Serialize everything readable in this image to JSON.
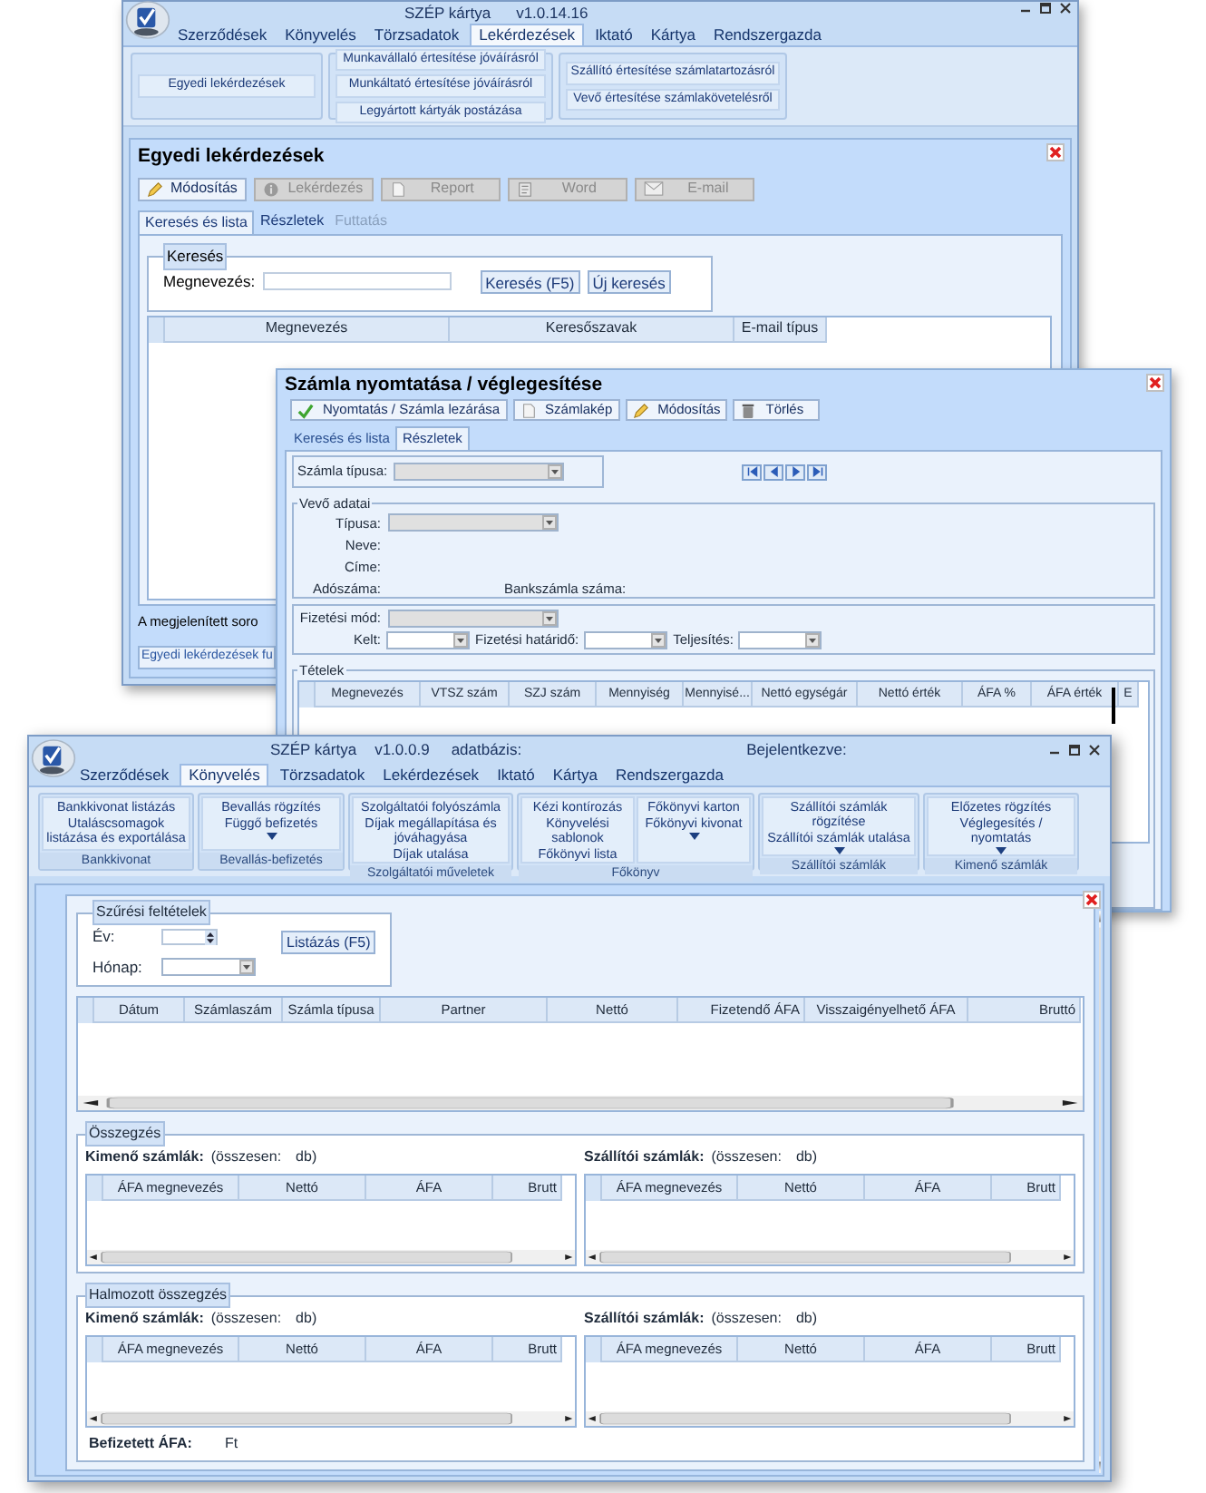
{
  "back_window": {
    "app_title": "SZÉP kártya",
    "version": "v1.0.14.16",
    "menu": [
      {
        "label": "Szerződések",
        "selected": false
      },
      {
        "label": "Könyvelés",
        "selected": false
      },
      {
        "label": "Törzsadatok",
        "selected": false
      },
      {
        "label": "Lekérdezések",
        "selected": true
      },
      {
        "label": "Iktató",
        "selected": false
      },
      {
        "label": "Kártya",
        "selected": false
      },
      {
        "label": "Rendszergazda",
        "selected": false
      }
    ],
    "ribbon": [
      {
        "items": [
          "Egyedi lekérdezések"
        ]
      },
      {
        "items": [
          "Munkavállaló értesítése jóváírásról",
          "Munkáltató értesítése jóváírásról",
          "Legyártott kártyák postázása"
        ]
      },
      {
        "items": [
          "Szállító értesítése számlatartozásról",
          "Vevő értesítése számlakövetelésről"
        ]
      }
    ],
    "panel": {
      "title": "Egyedi lekérdezések",
      "toolbar": [
        {
          "label": "Módosítás",
          "kind": "pencil",
          "disabled": false
        },
        {
          "label": "Lekérdezés",
          "kind": "info",
          "disabled": true
        },
        {
          "label": "Report",
          "kind": "doc",
          "disabled": true
        },
        {
          "label": "Word",
          "kind": "word",
          "disabled": true
        },
        {
          "label": "E-mail",
          "kind": "mail",
          "disabled": true
        }
      ],
      "tabs": [
        {
          "label": "Keresés és lista",
          "selected": true,
          "disabled": false
        },
        {
          "label": "Részletek",
          "selected": false,
          "disabled": false
        },
        {
          "label": "Futtatás",
          "selected": false,
          "disabled": true
        }
      ],
      "search_group": {
        "title": "Keresés",
        "field_label": "Megnevezés:",
        "buttons": [
          "Keresés (F5)",
          "Új keresés"
        ]
      },
      "grid_columns": [
        "Megnevezés",
        "Keresőszavak",
        "E-mail típus"
      ],
      "footer_note": "A megjelenített soro",
      "bottom_tab": "Egyedi lekérdezések fu"
    }
  },
  "dialog_window": {
    "title": "Számla nyomtatása / véglegesítése",
    "toolbar": [
      {
        "label": "Nyomtatás / Számla lezárása",
        "kind": "check"
      },
      {
        "label": "Számlakép",
        "kind": "doc"
      },
      {
        "label": "Módosítás",
        "kind": "pencil"
      },
      {
        "label": "Törlés",
        "kind": "bin"
      }
    ],
    "tabs": [
      {
        "label": "Keresés és lista",
        "selected": false
      },
      {
        "label": "Részletek",
        "selected": true
      }
    ],
    "invoice_type": {
      "label": "Számla típusa:",
      "disabled": true
    },
    "customer_group": {
      "title": "Vevő adatai",
      "type_label": "Típusa:",
      "type_disabled": true,
      "name_label": "Neve:",
      "address_label": "Címe:",
      "tax_label": "Adószáma:",
      "bank_label": "Bankszámla száma:"
    },
    "payment": {
      "method_label": "Fizetési mód:",
      "method_disabled": true,
      "dates": [
        {
          "label": "Kelt:",
          "disabled": false
        },
        {
          "label": "Fizetési határidő:",
          "disabled": false
        },
        {
          "label": "Teljesítés:",
          "disabled": false
        }
      ]
    },
    "items_group": {
      "title": "Tételek",
      "columns": [
        "Megnevezés",
        "VTSZ szám",
        "SZJ szám",
        "Mennyiség",
        "Mennyisé...",
        "Nettó egységár",
        "Nettó érték",
        "ÁFA %",
        "ÁFA érték",
        "E"
      ]
    }
  },
  "front_window": {
    "app_title": "SZÉP kártya",
    "version": "v1.0.0.9",
    "database_label": "adatbázis:",
    "login_label": "Bejelentkezve:",
    "menu": [
      {
        "label": "Szerződések",
        "selected": false
      },
      {
        "label": "Könyvelés",
        "selected": true
      },
      {
        "label": "Törzsadatok",
        "selected": false
      },
      {
        "label": "Lekérdezések",
        "selected": false
      },
      {
        "label": "Iktató",
        "selected": false
      },
      {
        "label": "Kártya",
        "selected": false
      },
      {
        "label": "Rendszergazda",
        "selected": false
      }
    ],
    "ribbon": [
      {
        "label": "Bankkivonat",
        "columns": [
          [
            "Bankkivonat listázás",
            "Utaláscsomagok listázása és exportálása"
          ]
        ],
        "has_more": false
      },
      {
        "label": "Bevallás-befizetés",
        "columns": [
          [
            "Bevallás rögzítés",
            "Függő befizetés"
          ]
        ],
        "has_more": true
      },
      {
        "label": "Szolgáltatói műveletek",
        "columns": [
          [
            "Szolgáltatói folyószámla",
            "Díjak megállapítása és jóváhagyása",
            "Díjak utalása"
          ]
        ],
        "has_more": false
      },
      {
        "label": "Főkönyv",
        "columns": [
          [
            "Kézi kontírozás",
            "Könyvelési sablonok",
            "Főkönyvi lista"
          ],
          [
            "Főkönyvi karton",
            "Főkönyvi kivonat"
          ]
        ],
        "has_more": true
      },
      {
        "label": "Szállítói számlák",
        "columns": [
          [
            "Szállítói számlák rögzítése",
            "Szállítói számlák utalása"
          ]
        ],
        "has_more": true
      },
      {
        "label": "Kimenő számlák",
        "columns": [
          [
            "Előzetes rögzítés",
            "Véglegesítés / nyomtatás"
          ]
        ],
        "has_more": true
      }
    ],
    "filter": {
      "title": "Szűrési feltételek",
      "year_label": "Év:",
      "month_label": "Hónap:",
      "button": "Listázás (F5)"
    },
    "grid_columns": [
      "Dátum",
      "Számlaszám",
      "Számla típusa",
      "Partner",
      "Nettó",
      "Fizetendő ÁFA",
      "Visszaigényelhető ÁFA",
      "Bruttó"
    ],
    "summaries": [
      {
        "title": "Összegzés",
        "parts": [
          {
            "label": "Kimenő számlák:",
            "total_label": "(összesen:",
            "unit": "db)",
            "columns": [
              "ÁFA megnevezés",
              "Nettó",
              "ÁFA",
              "Brutt"
            ]
          },
          {
            "label": "Szállítói számlák:",
            "total_label": "(összesen:",
            "unit": "db)",
            "columns": [
              "ÁFA megnevezés",
              "Nettó",
              "ÁFA",
              "Brutt"
            ]
          }
        ]
      },
      {
        "title": "Halmozott összegzés",
        "parts": [
          {
            "label": "Kimenő számlák:",
            "total_label": "(összesen:",
            "unit": "db)",
            "columns": [
              "ÁFA megnevezés",
              "Nettó",
              "ÁFA",
              "Brutt"
            ]
          },
          {
            "label": "Szállítói számlák:",
            "total_label": "(összesen:",
            "unit": "db)",
            "columns": [
              "ÁFA megnevezés",
              "Nettó",
              "ÁFA",
              "Brutt"
            ]
          }
        ]
      }
    ],
    "paid_vat": {
      "label": "Befizetett ÁFA:",
      "unit": "Ft"
    }
  }
}
